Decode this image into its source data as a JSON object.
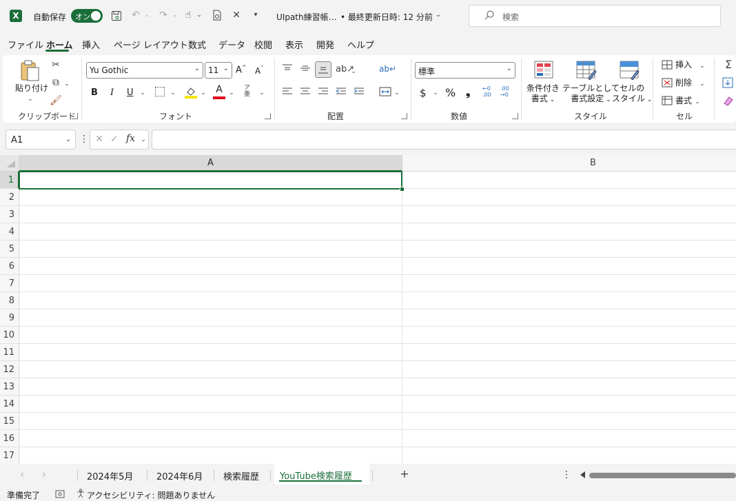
{
  "titlebar": {
    "autosave_label": "自動保存",
    "autosave_state": "オン",
    "filename": "UIpath練習帳…",
    "saved_status": "• 最終更新日時: 12 分前",
    "search_placeholder": "検索"
  },
  "tabs": [
    "ファイル",
    "ホーム",
    "挿入",
    "ページ レイアウト",
    "数式",
    "データ",
    "校閲",
    "表示",
    "開発",
    "ヘルプ"
  ],
  "active_tab": "ホーム",
  "ribbon": {
    "clipboard": {
      "paste_label": "貼り付け",
      "group_label": "クリップボード"
    },
    "font": {
      "font_name": "Yu Gothic",
      "font_size": "11",
      "bold": "B",
      "italic": "I",
      "underline": "U",
      "group_label": "フォント"
    },
    "alignment": {
      "group_label": "配置"
    },
    "number": {
      "format": "標準",
      "currency": "$",
      "percent": "%",
      "comma": "❟",
      "inc_decimal": "←0\n.00",
      "dec_decimal": ".00\n→0",
      "group_label": "数値"
    },
    "styles": {
      "conditional_line1": "条件付き",
      "conditional_line2": "書式",
      "table_line1": "テーブルとして",
      "table_line2": "書式設定",
      "cell_line1": "セルの",
      "cell_line2": "スタイル",
      "group_label": "スタイル"
    },
    "cells": {
      "insert": "挿入",
      "delete": "削除",
      "format": "書式",
      "group_label": "セル"
    }
  },
  "formula_bar": {
    "name_box": "A1",
    "fx": "fx",
    "value": ""
  },
  "grid": {
    "columns": [
      "A",
      "B"
    ],
    "rows": [
      "1",
      "2",
      "3",
      "4",
      "5",
      "6",
      "7",
      "8",
      "9",
      "10",
      "11",
      "12",
      "13",
      "14",
      "15",
      "16",
      "17"
    ],
    "active_cell": "A1"
  },
  "sheets": [
    "2024年5月",
    "2024年6月",
    "検索履歴",
    "YouTube検索履歴"
  ],
  "active_sheet": "YouTube検索履歴",
  "status": {
    "ready": "準備完了",
    "accessibility": "アクセシビリティ: 問題ありません"
  },
  "colors": {
    "accent": "#1b6e3a",
    "fill_color": "#f5e400",
    "font_color": "#e0001a"
  }
}
